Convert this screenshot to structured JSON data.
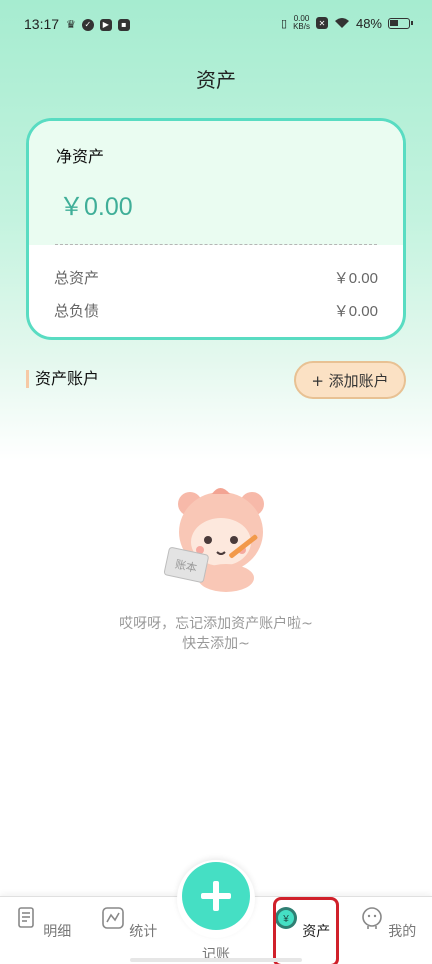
{
  "status_bar": {
    "time": "13:17",
    "speed_value": "0.00",
    "speed_unit": "KB/s",
    "battery": "48%"
  },
  "page": {
    "title": "资产"
  },
  "summary_card": {
    "net_label": "净资产",
    "net_value": "￥0.00",
    "total_assets_label": "总资产",
    "total_assets_value": "￥0.00",
    "total_liabilities_label": "总负债",
    "total_liabilities_value": "￥0.00"
  },
  "accounts_section": {
    "title": "资产账户",
    "add_button_label": "+ 添加账户"
  },
  "empty_state": {
    "line1": "哎呀呀，忘记添加资产账户啦~",
    "line2": "快去添加~",
    "mascot_board_text": "账本"
  },
  "bottom_nav": {
    "items": [
      {
        "label": "明细",
        "icon": "document-icon"
      },
      {
        "label": "统计",
        "icon": "chart-icon"
      },
      {
        "label": "记账",
        "icon": "plus-icon"
      },
      {
        "label": "资产",
        "icon": "yen-icon"
      },
      {
        "label": "我的",
        "icon": "profile-icon"
      }
    ],
    "active_index": 3
  },
  "colors": {
    "accent": "#45dfc4",
    "card_border": "#59dcc2",
    "net_value": "#3fae98",
    "add_button_bg": "#fbe1c4",
    "highlight_box": "#d0202a"
  }
}
